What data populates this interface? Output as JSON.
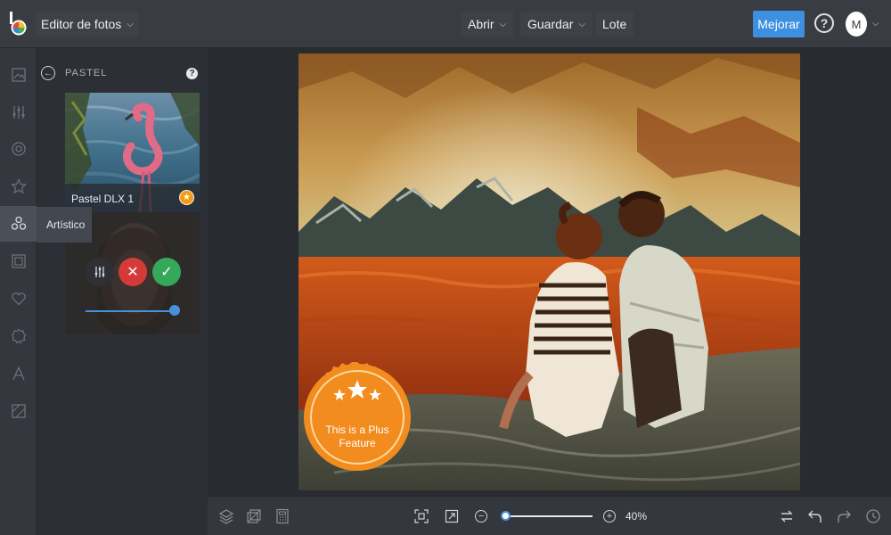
{
  "topbar": {
    "app_title": "Editor de fotos",
    "menus": [
      {
        "label": "Abrir"
      },
      {
        "label": "Guardar"
      },
      {
        "label": "Lote"
      }
    ],
    "upgrade_label": "Mejorar",
    "help_symbol": "?",
    "avatar_initial": "M"
  },
  "rail": {
    "items": [
      {
        "icon": "image-icon"
      },
      {
        "icon": "adjust-sliders-icon"
      },
      {
        "icon": "eye-icon"
      },
      {
        "icon": "star-icon"
      },
      {
        "icon": "artistic-icon",
        "active": true
      },
      {
        "icon": "frame-icon"
      },
      {
        "icon": "heart-icon"
      },
      {
        "icon": "badge-icon"
      },
      {
        "icon": "text-icon"
      },
      {
        "icon": "texture-icon"
      }
    ],
    "tooltip": "Artístico"
  },
  "panel": {
    "title": "PASTEL",
    "help_symbol": "?",
    "effects": [
      {
        "name": "Pastel DLX 1",
        "premium": true
      }
    ],
    "active_effect_intensity_pct": 100
  },
  "canvas": {
    "plus_badge_line1": "This is a Plus",
    "plus_badge_line2": "Feature"
  },
  "bottombar": {
    "zoom_minus": "−",
    "zoom_plus": "+",
    "zoom_level": "40%",
    "zoom_fraction": 0.03
  },
  "colors": {
    "accent": "#3d8fe0",
    "cancel": "#d43a3a",
    "apply": "#36a85a",
    "premium": "#f39c12"
  }
}
